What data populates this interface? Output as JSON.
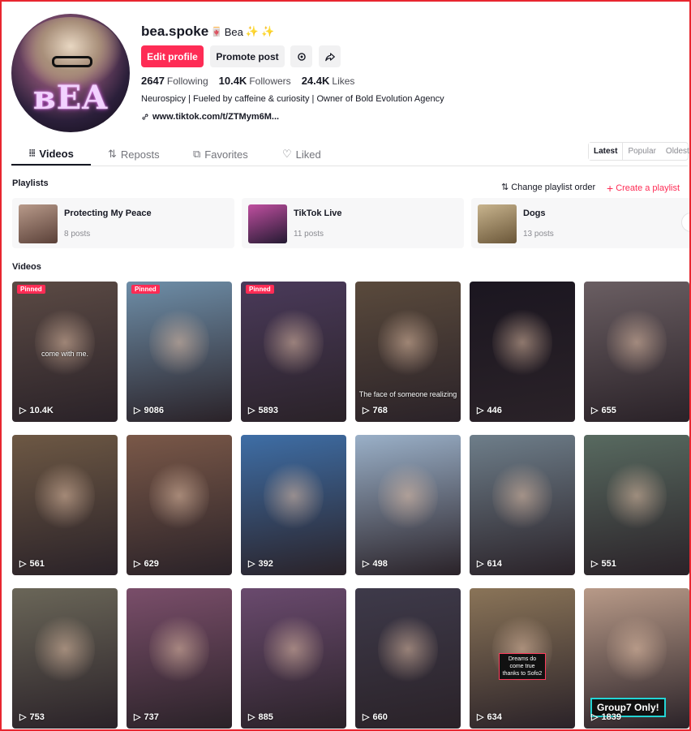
{
  "profile": {
    "username": "bea.spoke",
    "nickname": "Bea",
    "nickname_emoji_flag": "🀄",
    "nickname_sparkles": [
      "✨",
      "✨"
    ],
    "avatar_text": "BEA",
    "edit_profile": "Edit profile",
    "promote_post": "Promote post",
    "stats": [
      {
        "value": "2647",
        "label": "Following"
      },
      {
        "value": "10.4K",
        "label": "Followers"
      },
      {
        "value": "24.4K",
        "label": "Likes"
      }
    ],
    "bio": "Neurospicy | Fueled by caffeine & curiosity | Owner of Bold Evolution Agency",
    "link": "www.tiktok.com/t/ZTMym6M..."
  },
  "tabs": [
    {
      "label": "Videos",
      "icon": "grid-icon",
      "active": true
    },
    {
      "label": "Reposts",
      "icon": "repost-icon",
      "active": false
    },
    {
      "label": "Favorites",
      "icon": "bookmark-icon",
      "active": false
    },
    {
      "label": "Liked",
      "icon": "heart-icon",
      "active": false
    }
  ],
  "sort": [
    "Latest",
    "Popular",
    "Oldest"
  ],
  "playlists": {
    "title": "Playlists",
    "change_order": "Change playlist order",
    "create": "Create a playlist",
    "items": [
      {
        "name": "Protecting My Peace",
        "count": "8 posts",
        "color": "#8a6a5a"
      },
      {
        "name": "TikTok Live",
        "count": "11 posts",
        "color": "#3d2a4a"
      },
      {
        "name": "Dogs",
        "count": "13 posts",
        "color": "#9a8a6e"
      }
    ]
  },
  "videos": {
    "title": "Videos",
    "pinned_label": "Pinned",
    "items": [
      {
        "views": "10.4K",
        "pinned": true,
        "caption": "come with me.",
        "bg": "#5b4a44"
      },
      {
        "views": "9086",
        "pinned": true,
        "caption": "",
        "bg": "#6e8ea8"
      },
      {
        "views": "5893",
        "pinned": true,
        "caption": "",
        "bg": "#4a3a5a"
      },
      {
        "views": "768",
        "pinned": false,
        "caption": "The face of someone realizing",
        "bg": "#5a4a3c"
      },
      {
        "views": "446",
        "pinned": false,
        "caption": "",
        "bg": "#1b1620"
      },
      {
        "views": "655",
        "pinned": false,
        "caption": "",
        "bg": "#6a5e62"
      },
      {
        "views": "561",
        "pinned": false,
        "caption": "",
        "bg": "#6d5844"
      },
      {
        "views": "629",
        "pinned": false,
        "caption": "",
        "bg": "#7a5848"
      },
      {
        "views": "392",
        "pinned": false,
        "caption": "",
        "bg": "#3e6ea6"
      },
      {
        "views": "498",
        "pinned": false,
        "caption": "",
        "bg": "#9ab0c8"
      },
      {
        "views": "614",
        "pinned": false,
        "caption": "",
        "bg": "#6e7e8a"
      },
      {
        "views": "551",
        "pinned": false,
        "caption": "",
        "bg": "#586a60"
      },
      {
        "views": "753",
        "pinned": false,
        "caption": "",
        "bg": "#6a6658"
      },
      {
        "views": "737",
        "pinned": false,
        "caption": "",
        "bg": "#7a4e6a"
      },
      {
        "views": "885",
        "pinned": false,
        "caption": "",
        "bg": "#6a4a6e"
      },
      {
        "views": "660",
        "pinned": false,
        "caption": "",
        "bg": "#3e3a4a"
      },
      {
        "views": "634",
        "pinned": false,
        "caption": "Dreams do come true thanks to Sofo2",
        "bg": "#8a7458"
      },
      {
        "views": "1839",
        "pinned": false,
        "caption": "Group7 Only!",
        "bg": "#b89a88"
      }
    ]
  },
  "colors": {
    "accent": "#fe2c55",
    "text": "#161823",
    "muted": "#73747b"
  }
}
